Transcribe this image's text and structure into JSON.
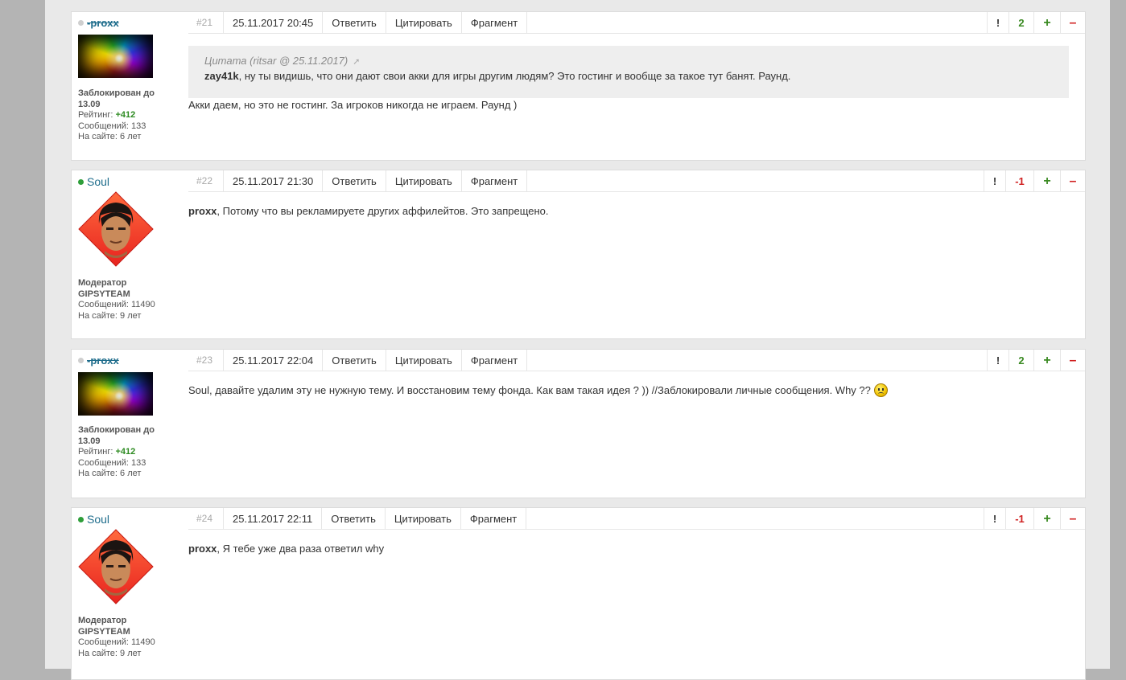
{
  "labels": {
    "reply": "Ответить",
    "quote": "Цитировать",
    "fragment": "Фрагмент",
    "report": "!",
    "plus": "+",
    "minus": "–"
  },
  "colors": {
    "page_bg": "#e9e9e9",
    "rating_positive": "#3a8a22",
    "rating_negative": "#d02020",
    "username": "#1f6d8c",
    "online_dot": "#2e9e3a"
  },
  "posts": [
    {
      "username": "-proxx",
      "status": "offline-banned",
      "avatar": "rainbow-burst-avatar",
      "user_line1": "Заблокирован до",
      "user_line2": "13.09",
      "rating_label": "Рейтинг: ",
      "rating_value": "+412",
      "messages": "Сообщений: 133",
      "on_site": "На сайте: 6 лет",
      "number": "#21",
      "datetime": "25.11.2017 20:45",
      "post_rating": "2",
      "quote_header": "Цитата (ritsar @ 25.11.2017)",
      "quote_author": "zay41k",
      "quote_text": ", ну ты видишь, что они дают свои акки для игры другим людям? Это гостинг и вообще за такое тут банят. Раунд.",
      "text": "Акки даем, но это не гостинг. За игроков никогда не играем. Раунд )"
    },
    {
      "username": "Soul",
      "status": "online",
      "avatar": "moderator-face-avatar",
      "user_line1": "Модератор",
      "user_line2": "GIPSYTEAM",
      "messages": "Сообщений: 11490",
      "on_site": "На сайте: 9 лет",
      "number": "#22",
      "datetime": "25.11.2017 21:30",
      "post_rating": "-1",
      "mention": "proxx",
      "text": ", Потому что вы рекламируете других аффилейтов. Это запрещено."
    },
    {
      "username": "-proxx",
      "status": "offline-banned",
      "avatar": "rainbow-burst-avatar",
      "user_line1": "Заблокирован до",
      "user_line2": "13.09",
      "rating_label": "Рейтинг: ",
      "rating_value": "+412",
      "messages": "Сообщений: 133",
      "on_site": "На сайте: 6 лет",
      "number": "#23",
      "datetime": "25.11.2017 22:04",
      "post_rating": "2",
      "text": "Soul, давайте удалим эту не нужную тему. И восстановим тему фонда. Как вам такая идея ? )) //Заблокировали личные сообщения. Why ??",
      "emoji": "sad-smiley-icon"
    },
    {
      "username": "Soul",
      "status": "online",
      "avatar": "moderator-face-avatar",
      "user_line1": "Модератор",
      "user_line2": "GIPSYTEAM",
      "messages": "Сообщений: 11490",
      "on_site": "На сайте: 9 лет",
      "number": "#24",
      "datetime": "25.11.2017 22:11",
      "post_rating": "-1",
      "mention": "proxx",
      "text": ", Я тебе уже два раза ответил why"
    }
  ]
}
